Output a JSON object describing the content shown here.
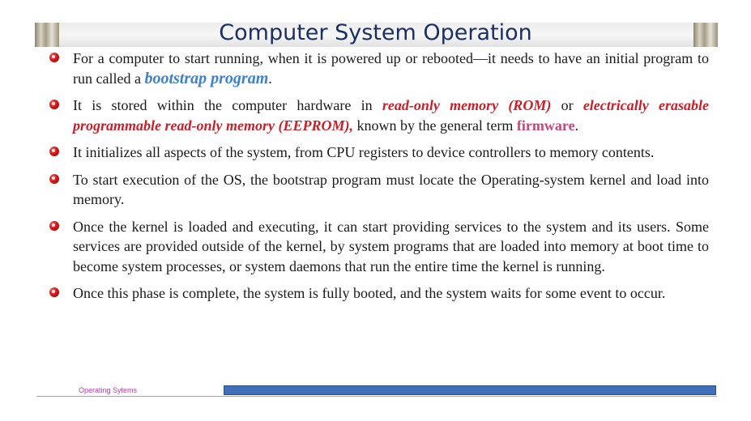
{
  "slide": {
    "title": "Computer System Operation",
    "bullets": [
      {
        "parts": [
          {
            "text": "For a computer to start running, when it is powered up or rebooted—it needs to have an initial program to run called a ",
            "style": "plain"
          },
          {
            "text": "bootstrap program",
            "style": "blue"
          },
          {
            "text": ".",
            "style": "plain"
          }
        ]
      },
      {
        "parts": [
          {
            "text": "It is stored within the computer hardware in ",
            "style": "plain"
          },
          {
            "text": "read-only memory (ROM)",
            "style": "red"
          },
          {
            "text": " or ",
            "style": "plain"
          },
          {
            "text": "electrically erasable programmable read-only memory (EEPROM),",
            "style": "red"
          },
          {
            "text": " known by the general term ",
            "style": "plain"
          },
          {
            "text": "firmware",
            "style": "pink"
          },
          {
            "text": ".",
            "style": "plain"
          }
        ]
      },
      {
        "parts": [
          {
            "text": "It initializes all aspects of the system, from CPU registers to device controllers to memory contents.",
            "style": "plain"
          }
        ]
      },
      {
        "parts": [
          {
            "text": "To start execution of the OS, the bootstrap program must locate the Operating-system kernel and load into memory.",
            "style": "plain"
          }
        ]
      },
      {
        "parts": [
          {
            "text": "Once the kernel is loaded and executing, it can start providing services to the system and its users. Some services are provided outside of the kernel, by system programs that are loaded into memory at boot time to become system processes, or system daemons that run the entire time the kernel is running.",
            "style": "plain"
          }
        ]
      },
      {
        "parts": [
          {
            "text": "Once this phase is complete, the system is fully booted, and the system waits for some event to occur.",
            "style": "plain"
          }
        ]
      }
    ],
    "footer": "Operating Sytems"
  },
  "colors": {
    "title": "#1b2f63",
    "highlight_blue": "#3d7fd0",
    "highlight_red": "#c8202a",
    "highlight_pink": "#c2477e",
    "footer_text": "#b13ea3",
    "footer_bar": "#3f6fb8"
  },
  "icons": {
    "bullet": "red-sphere-bullet-icon"
  }
}
